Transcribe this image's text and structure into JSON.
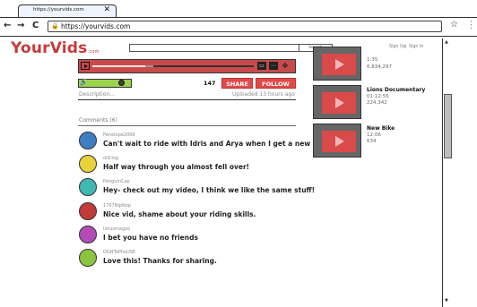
{
  "browser": {
    "tab_title": "https://yourvids.com",
    "tab_close": "✕",
    "back": "←",
    "forward": "→",
    "reload": "C",
    "url": "https://yourvids.com",
    "star": "☆",
    "menu": "⋮"
  },
  "site": {
    "logo": "YourVids",
    "logo_suffix": ".com",
    "search_button": "Search",
    "sign_up": "Sign Up",
    "sign_in": "Sign In"
  },
  "video": {
    "progress_fraction": 0.33,
    "buffer_fraction": 0.05,
    "volume_fraction": 0.85,
    "views": "147",
    "share_label": "SHARE",
    "follow_label": "FOLLOW",
    "description_label": "Description...",
    "uploaded": "Uploaded 13 hours ago"
  },
  "comments": {
    "header": "Comments (6)",
    "items": [
      {
        "user": "Penelope2009",
        "text": "Can't wait to ride with Idris and Arya when I get a new bike.",
        "color": "#3e7fc1"
      },
      {
        "user": "oliClog",
        "text": "Half way through you almost fell over!",
        "color": "#e8d23a"
      },
      {
        "user": "PenguinCap",
        "text": "Hey- check out my video, I think we like the same stuff!",
        "color": "#3fb9b2"
      },
      {
        "user": "1707NipNop",
        "text": "Nice vid, shame about your riding skills.",
        "color": "#c23a3a"
      },
      {
        "user": "Ishusmagoo",
        "text": "I bet you have no friends",
        "color": "#b24bb8"
      },
      {
        "user": "OGHToPhoUSE",
        "text": "Love this! Thanks for sharing.",
        "color": "#8bc43f"
      }
    ]
  },
  "sidebar": {
    "items": [
      {
        "title": "",
        "duration": "1:35",
        "views": "6,834,297"
      },
      {
        "title": "Lions Documentary",
        "duration": "01:12:55",
        "views": "224,342"
      },
      {
        "title": "New Bike",
        "duration": "12:06",
        "views": "634"
      }
    ]
  }
}
